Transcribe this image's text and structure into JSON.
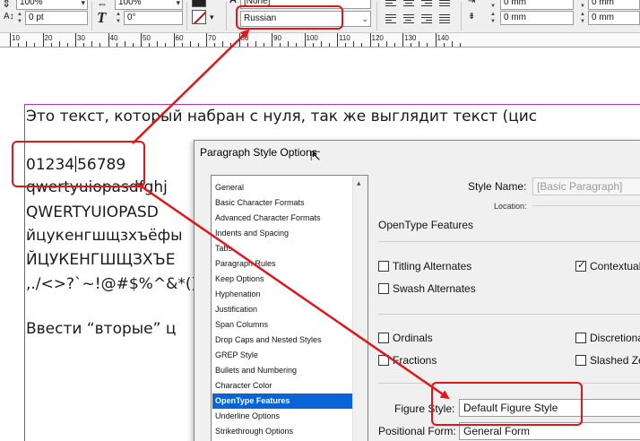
{
  "toolbar": {
    "font_size_pct": "100%",
    "tracking_pct": "100%",
    "baseline_shift": "0 pt",
    "skew": "0°",
    "language": "Russian",
    "char_style": "[None]",
    "indent_right": "0 mm",
    "indent_right_2": "0 mm",
    "space_after": "0 mm",
    "space_after_2": "0 mm"
  },
  "ruler": {
    "labels": [
      "10",
      "20",
      "30",
      "40",
      "50",
      "60",
      "70",
      "80",
      "90",
      "100",
      "110",
      "120",
      "130",
      "140"
    ]
  },
  "document": {
    "line1": "Это текст, который набран с нуля, так же выглядит текст (цис",
    "line2_before_cursor": "01234",
    "line2_after_cursor": "56789",
    "line3": "qwertyuiopasdfghj",
    "line4": "QWERTYUIOPASD",
    "line5": "йцукенгшщзхъёфы",
    "line6": "ЙЦУКЕНГШЩЗХЪЕ",
    "line7": ",./<>?`~!@#$%^&*()_",
    "line8": "Ввести “вторые” ц"
  },
  "dialog": {
    "title": "Paragraph Style Options",
    "categories": [
      "General",
      "Basic Character Formats",
      "Advanced Character Formats",
      "Indents and Spacing",
      "Tabs",
      "Paragraph Rules",
      "Keep Options",
      "Hyphenation",
      "Justification",
      "Span Columns",
      "Drop Caps and Nested Styles",
      "GREP Style",
      "Bullets and Numbering",
      "Character Color",
      "OpenType Features",
      "Underline Options",
      "Strikethrough Options"
    ],
    "selected_category": "OpenType Features",
    "style_name_label": "Style Name:",
    "style_name_value": "[Basic Paragraph]",
    "location_label": "Location:",
    "section_title": "OpenType Features",
    "titling_alternates": "Titling Alternates",
    "contextual": "Contextual",
    "swash_alternates": "Swash Alternates",
    "ordinals": "Ordinals",
    "discretionary": "Discretiona",
    "fractions": "Fractions",
    "slashed_zero": "Slashed Ze",
    "figure_style_label": "Figure Style:",
    "figure_style_value": "Default Figure Style",
    "positional_form_label": "Positional Form:",
    "positional_form_value": "General Form"
  },
  "colors": {
    "annotation": "#e0161b",
    "selection": "#0a64d8",
    "frame": "#c030c0"
  }
}
